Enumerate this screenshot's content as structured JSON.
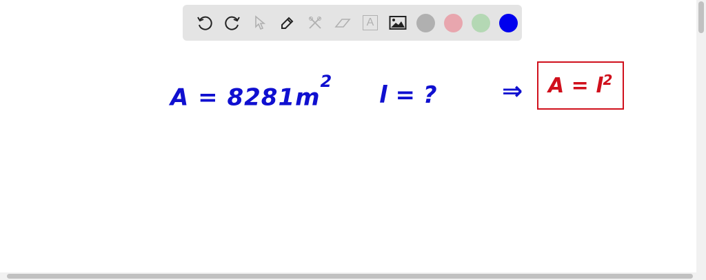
{
  "toolbar": {
    "tools": [
      "undo",
      "redo",
      "select",
      "pen",
      "tools",
      "eraser",
      "text",
      "image"
    ],
    "colors": [
      "#b0b0b0",
      "#e8a6ae",
      "#b4d8b4",
      "#0000ee"
    ],
    "text_tool_label": "A"
  },
  "board": {
    "area_eq": "A = 8281m",
    "area_exp": "2",
    "side_eq": "l = ?",
    "arrow": "⇒",
    "formula": "A = l",
    "formula_exp": "2"
  }
}
